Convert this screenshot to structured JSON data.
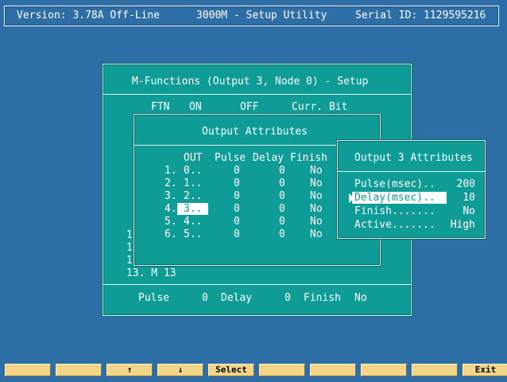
{
  "titlebar": {
    "version": "Version: 3.78A Off-Line",
    "app": "3000M - Setup Utility",
    "serial": "Serial ID: 1129595216"
  },
  "mfunc": {
    "title": "M-Functions (Output 3, Node 0) - Setup",
    "headers": [
      "FTN",
      "ON",
      "OFF",
      "Curr. Bit"
    ],
    "left_rows": [
      "1",
      "1",
      "1"
    ],
    "row13": "13. M 13",
    "footer": {
      "pulse_label": "Pulse",
      "pulse_value": "0",
      "delay_label": "Delay",
      "delay_value": "0",
      "finish_label": "Finish",
      "finish_value": "No"
    }
  },
  "output_attrs": {
    "title": "Output Attributes",
    "headers": [
      "OUT",
      "Pulse",
      "Delay",
      "Finish"
    ],
    "rows": [
      {
        "idx": "1.",
        "out": "0..",
        "pulse": "0",
        "delay": "0",
        "finish": "No"
      },
      {
        "idx": "2.",
        "out": "1..",
        "pulse": "0",
        "delay": "0",
        "finish": "No"
      },
      {
        "idx": "3.",
        "out": "2..",
        "pulse": "0",
        "delay": "0",
        "finish": "No"
      },
      {
        "idx": "4.",
        "out": "3..",
        "pulse": "0",
        "delay": "0",
        "finish": "No"
      },
      {
        "idx": "5.",
        "out": "4..",
        "pulse": "0",
        "delay": "0",
        "finish": "No"
      },
      {
        "idx": "6.",
        "out": "5..",
        "pulse": "0",
        "delay": "0",
        "finish": "No"
      }
    ],
    "selected_row": 3
  },
  "output3": {
    "title": "Output 3 Attributes",
    "fields": [
      {
        "label": "Pulse(msec)..",
        "value": "200"
      },
      {
        "label": "Delay(msec)..",
        "value": "10"
      },
      {
        "label": "Finish.......",
        "value": "No"
      },
      {
        "label": "Active.......",
        "value": "High"
      }
    ],
    "selected_field": 1,
    "pointer_icon": "right-triangle-pointer"
  },
  "fkeys": [
    {
      "label": ""
    },
    {
      "label": ""
    },
    {
      "label": "↑"
    },
    {
      "label": "↓"
    },
    {
      "label": "Select"
    },
    {
      "label": ""
    },
    {
      "label": ""
    },
    {
      "label": ""
    },
    {
      "label": ""
    },
    {
      "label": "Exit"
    }
  ],
  "colors": {
    "background": "#2d6ea6",
    "dialog": "#0f9b96",
    "fkey": "#f3d58a"
  }
}
